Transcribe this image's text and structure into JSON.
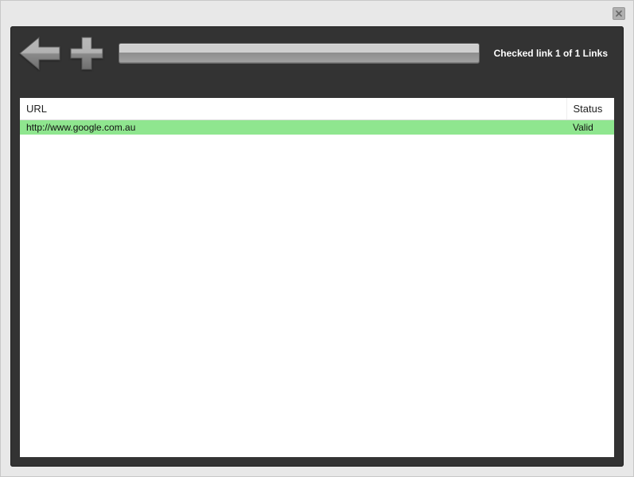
{
  "window": {
    "close_label": "x"
  },
  "toolbar": {
    "status": "Checked link 1 of 1 Links"
  },
  "table": {
    "headers": {
      "url": "URL",
      "status": "Status"
    },
    "rows": [
      {
        "url": "http://www.google.com.au",
        "status": "Valid",
        "row_class": "valid"
      }
    ]
  },
  "colors": {
    "panel_bg": "#333333",
    "valid_row": "#8fe68f"
  }
}
